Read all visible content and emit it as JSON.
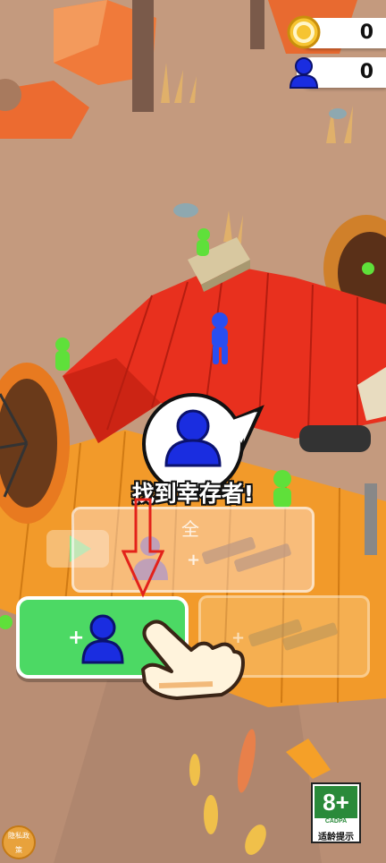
{
  "hud": {
    "coin_count": "0",
    "survivor_count": "0"
  },
  "caption": "找到幸存者!",
  "panel": {
    "full_label": "全",
    "plus": "+"
  },
  "green_button": {
    "plus": "+"
  },
  "age_badge": {
    "rating": "8+",
    "org": "CADPA",
    "tip": "适龄提示"
  },
  "privacy": {
    "label": "隐私政策"
  },
  "colors": {
    "ground": "#c49a7e",
    "platform_red": "#e8301e",
    "wood_orange": "#f29a2a",
    "button_green": "#4cd964",
    "survivor_blue": "#1a2de0"
  },
  "icons": [
    "coin-icon",
    "survivor-icon",
    "play-icon",
    "gun-icon",
    "hand-pointer-icon",
    "arrow-down-icon"
  ]
}
